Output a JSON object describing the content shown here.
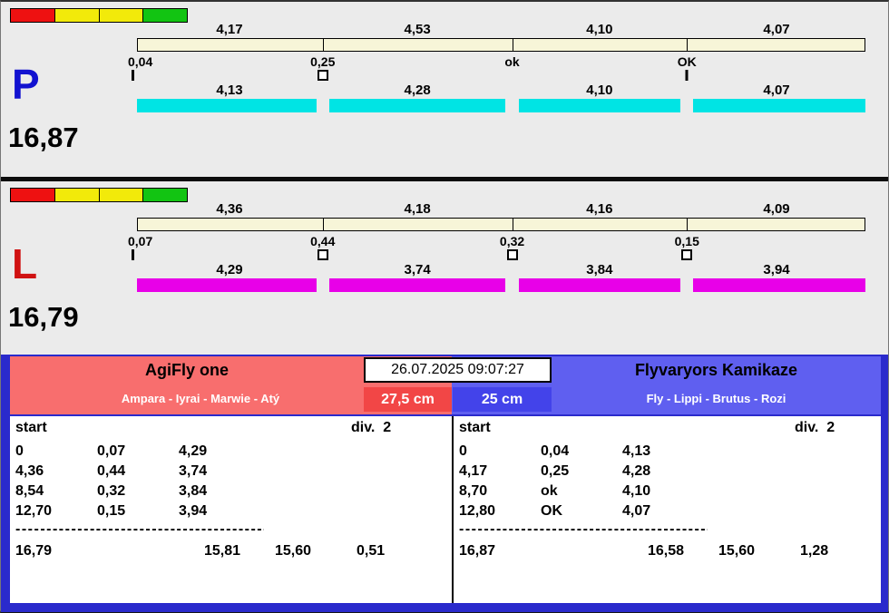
{
  "panels": [
    {
      "letter": "P",
      "letter_color": "#1212d0",
      "total": "16,87",
      "bar_color": "#00e4e4",
      "lights": [
        "#ee1111",
        "#f2ea0a",
        "#f2ea0a",
        "#12c412"
      ],
      "top_values": [
        "4,17",
        "4,53",
        "4,10",
        "4,07"
      ],
      "markers": [
        "0,04",
        "0,25",
        "ok",
        "OK"
      ],
      "marker_glyphs": [
        "tick",
        "box",
        "none",
        "tick"
      ],
      "bottom_values": [
        "4,13",
        "4,28",
        "4,10",
        "4,07"
      ]
    },
    {
      "letter": "L",
      "letter_color": "#d01212",
      "total": "16,79",
      "bar_color": "#e800e8",
      "lights": [
        "#ee1111",
        "#f2ea0a",
        "#f2ea0a",
        "#12c412"
      ],
      "top_values": [
        "4,36",
        "4,18",
        "4,16",
        "4,09"
      ],
      "markers": [
        "0,07",
        "0,44",
        "0,32",
        "0,15"
      ],
      "marker_glyphs": [
        "tick",
        "box",
        "box",
        "box"
      ],
      "bottom_values": [
        "4,29",
        "3,74",
        "3,84",
        "3,94"
      ]
    }
  ],
  "footer": {
    "datetime": "26.07.2025 09:07:27",
    "left_team": {
      "name": "AgiFly one",
      "members": "Ampara - Iyrai - Marwie - Atý",
      "height": "27,5 cm",
      "header_color": "#f86e6e",
      "height_color": "#f24646"
    },
    "right_team": {
      "name": "Flyvaryors Kamikaze",
      "members": "Fly - Lippi - Brutus - Rozi",
      "height": "25 cm",
      "header_color": "#5f5ff0",
      "height_color": "#4343ea"
    },
    "left_table": {
      "start_label": "start",
      "div_label": "div.  2",
      "rows": [
        [
          "0",
          "0,07",
          "4,29"
        ],
        [
          "4,36",
          "0,44",
          "3,74"
        ],
        [
          "8,54",
          "0,32",
          "3,84"
        ],
        [
          "12,70",
          "0,15",
          "3,94"
        ]
      ],
      "separator": "--------------------------------------------",
      "totals": [
        "16,79",
        "15,81",
        "15,60",
        "0,51"
      ]
    },
    "right_table": {
      "start_label": "start",
      "div_label": "div.  2",
      "rows": [
        [
          "0",
          "0,04",
          "4,13"
        ],
        [
          "4,17",
          "0,25",
          "4,28"
        ],
        [
          "8,70",
          "ok",
          "4,10"
        ],
        [
          "12,80",
          "OK",
          "4,07"
        ]
      ],
      "separator": "--------------------------------------------",
      "totals": [
        "16,87",
        "16,58",
        "15,60",
        "1,28"
      ]
    }
  }
}
